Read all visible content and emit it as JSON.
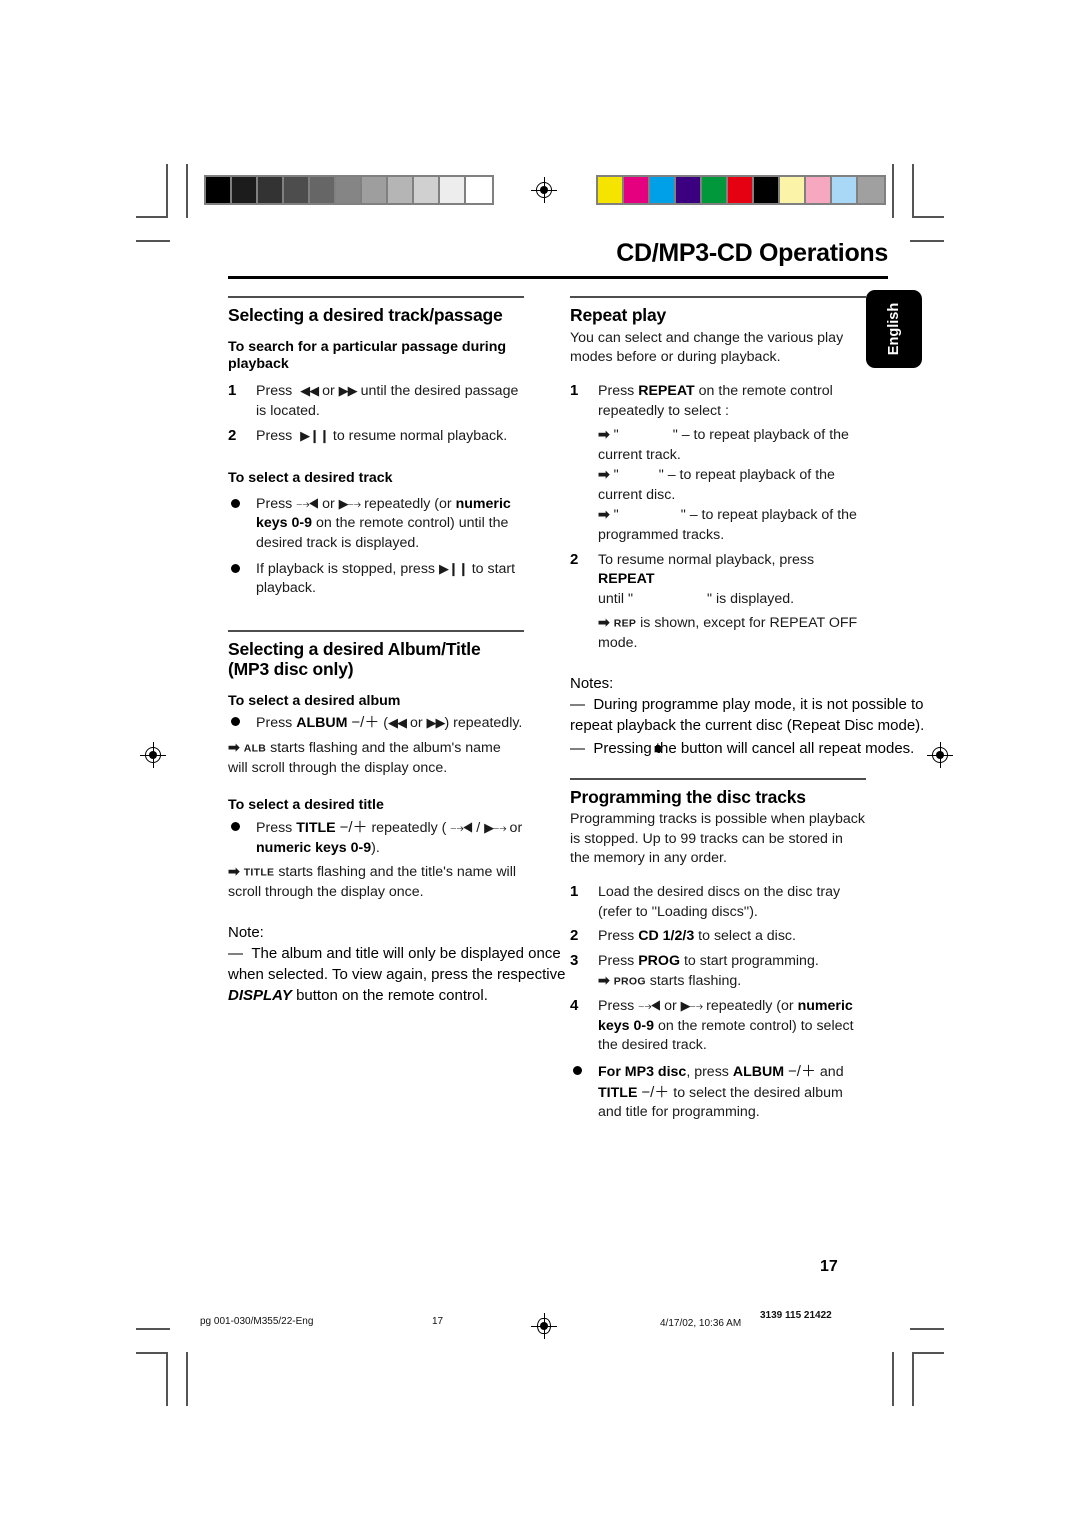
{
  "header": {
    "doc_title": "CD/MP3-CD Operations",
    "language_tab": "English"
  },
  "left_column": {
    "section1": {
      "heading": "Selecting a desired track/passage",
      "sub1": "To search for a particular passage during playback",
      "steps1": [
        {
          "num": "1",
          "text_before": "Press",
          "glyph1": "◀◀",
          "mid": "or",
          "glyph2": "▶▶",
          "text_after": "until the desired passage is located."
        },
        {
          "num": "2",
          "text_before": "Press",
          "glyph1": "▶Ⅱ",
          "text_after": "to resume normal playback."
        }
      ],
      "sub2": "To select a desired track",
      "bullets": [
        "Press ⏮ or ⏭ repeatedly (or numeric keys 0-9 on the remote control) until the desired track is displayed.",
        "If playback is stopped, press ▶Ⅱ to start playback."
      ]
    },
    "section2": {
      "heading": "Selecting a desired Album/Title (MP3 disc only)",
      "sub1": "To select a desired album",
      "album_bullet_pre": "Press",
      "album_bold": "ALBUM",
      "album_pm": "−/＋",
      "album_parens": "(◀◀ or ▶▶) repeatedly.",
      "album_arrow_ind": "ALB",
      "album_arrow_text": "starts flashing and the album's name will scroll through the display once.",
      "sub2": "To select a desired title",
      "title_bullet_pre": "Press",
      "title_bold": "TITLE",
      "title_pm": "−/＋",
      "title_mid": "repeatedly ( ⏮ / ⏭  or",
      "title_bold2": "numeric keys 0-9",
      "title_end": ").",
      "title_arrow_ind": "TITLE",
      "title_arrow_text": "starts flashing and the title's name will scroll through the display once.",
      "note_label": "Note:",
      "note_dash": "—",
      "note_line1": "The album and title will only be displayed once",
      "note_line2_a": "when selected. To view again, press the respective",
      "note_line3_bold": "DISPLAY",
      "note_line3_rest": "button on the remote control."
    }
  },
  "right_column": {
    "section1": {
      "heading": "Repeat play",
      "intro": "You can select and change the various play modes before or during playback.",
      "step1": {
        "num": "1",
        "line1_pre": "Press",
        "line1_bold": "REPEAT",
        "line1_post": "on the remote control repeatedly to select :",
        "options": [
          {
            "quoted": "",
            "desc": "– to repeat playback of the current track."
          },
          {
            "quoted": "",
            "desc": "– to repeat playback of the current disc."
          },
          {
            "quoted": "",
            "desc": "– to repeat playback of the programmed tracks."
          }
        ]
      },
      "step2": {
        "num": "2",
        "line1_pre": "To resume normal playback, press",
        "line1_bold": "REPEAT",
        "line2_pre": "until \"",
        "line2_post": "\" is displayed.",
        "arrow_ind": "REP",
        "arrow_text": "is shown, except for REPEAT OFF mode."
      },
      "notes_label": "Notes:",
      "note1_dash": "—",
      "note1": "During programme play mode, it is not possible to repeat playback the current disc (Repeat Disc mode).",
      "note2_dash": "—",
      "note2_pre": "Pressing",
      "note2_glyph": "■",
      "note2_post": "the button will cancel all repeat modes."
    },
    "section2": {
      "heading": "Programming the disc tracks",
      "intro": "Programming tracks is possible when playback is stopped. Up to 99 tracks can be stored in the memory in any order.",
      "steps": [
        {
          "num": "1",
          "text": "Load the desired discs on the disc tray (refer to ''Loading discs'')."
        },
        {
          "num": "2",
          "pre": "Press",
          "bold": "CD 1/2/3",
          "post": "to select a disc."
        },
        {
          "num": "3",
          "pre": "Press",
          "bold": "PROG",
          "post": "to start programming.",
          "arrow_ind": "PROG",
          "arrow_text": "starts flashing."
        },
        {
          "num": "4",
          "text": "Press ⏮ or ⏭ repeatedly (or numeric keys 0-9 on the remote control) to select the desired track."
        }
      ],
      "bullet": {
        "bold1": "For MP3 disc",
        "mid1": ", press",
        "bold2": "ALBUM",
        "pm1": "−/＋",
        "mid2": "and",
        "bold3": "TITLE",
        "pm2": "−/＋",
        "end": "to select the desired album and title for programming."
      }
    }
  },
  "page_number": "17",
  "footer": {
    "file": "pg 001-030/M355/22-Eng",
    "page": "17",
    "date": "4/17/02, 10:36 AM",
    "code": "3139 115 21422"
  },
  "print_marks": {
    "gray_bar": [
      "#000000",
      "#1c1c1c",
      "#333333",
      "#4d4d4d",
      "#666666",
      "#858585",
      "#9e9e9e",
      "#b5b5b5",
      "#d0d0d0",
      "#ededed",
      "#ffffff"
    ],
    "color_bar": [
      "#f5e400",
      "#e4007f",
      "#00a0e9",
      "#3b0080",
      "#00983a",
      "#e50012",
      "#000000",
      "#fbf3a8",
      "#f5a8c0",
      "#a8d8f5",
      "#a0a0a0"
    ]
  }
}
